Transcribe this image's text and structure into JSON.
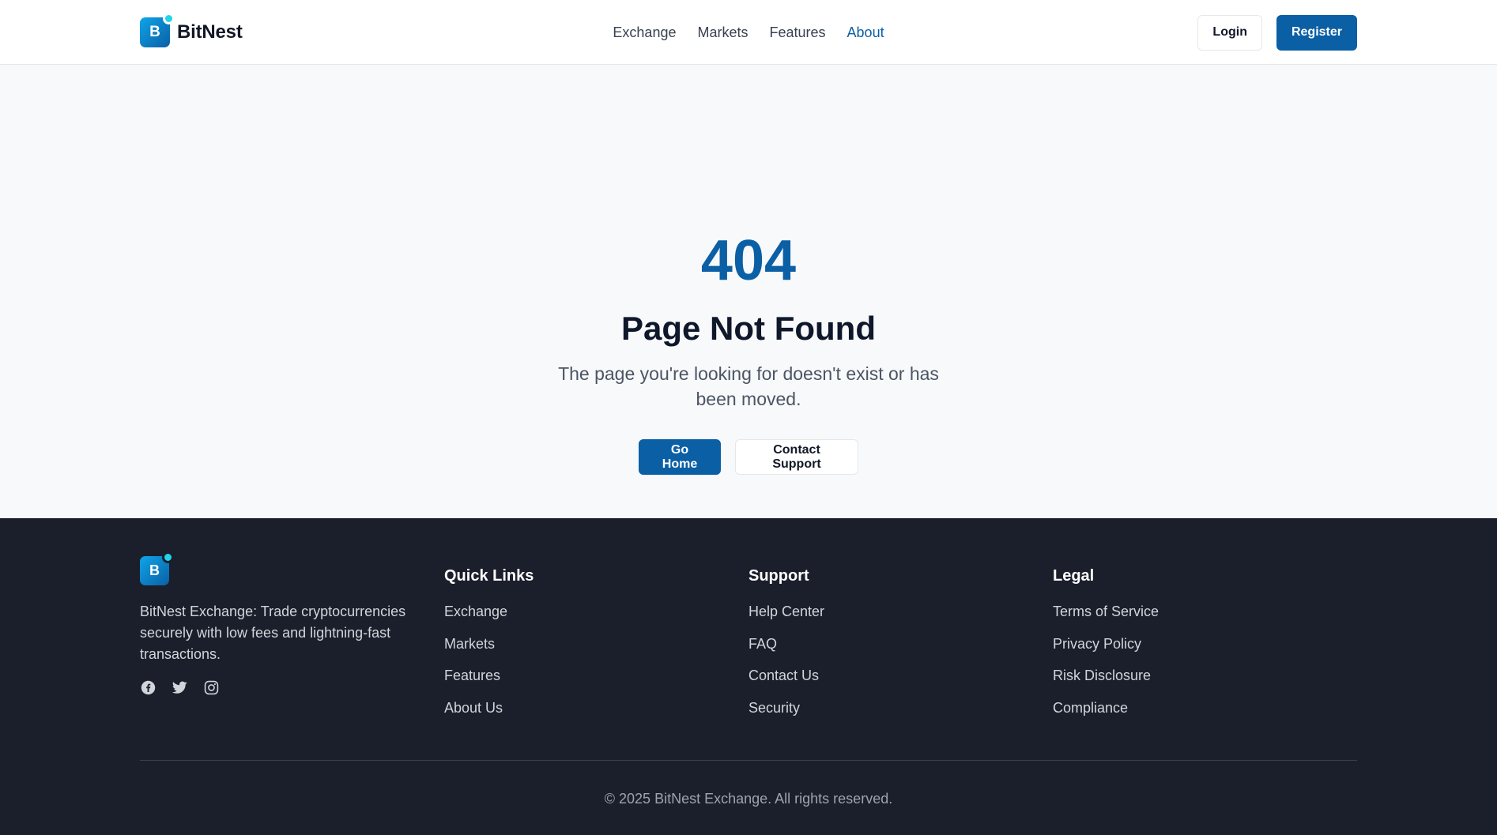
{
  "brand": {
    "name": "BitNest",
    "logo_letter": "B"
  },
  "nav": {
    "items": [
      {
        "label": "Exchange",
        "active": false
      },
      {
        "label": "Markets",
        "active": false
      },
      {
        "label": "Features",
        "active": false
      },
      {
        "label": "About",
        "active": true
      }
    ]
  },
  "header": {
    "login_label": "Login",
    "register_label": "Register"
  },
  "error": {
    "code": "404",
    "title": "Page Not Found",
    "message": "The page you're looking for doesn't exist or has been moved.",
    "home_label": "Go Home",
    "support_label": "Contact Support"
  },
  "footer": {
    "logo_letter": "B",
    "description": "BitNest Exchange: Trade cryptocurrencies securely with low fees and lightning-fast transactions.",
    "socials": [
      "facebook-icon",
      "twitter-icon",
      "instagram-icon"
    ],
    "columns": [
      {
        "heading": "Quick Links",
        "links": [
          "Exchange",
          "Markets",
          "Features",
          "About Us"
        ]
      },
      {
        "heading": "Support",
        "links": [
          "Help Center",
          "FAQ",
          "Contact Us",
          "Security"
        ]
      },
      {
        "heading": "Legal",
        "links": [
          "Terms of Service",
          "Privacy Policy",
          "Risk Disclosure",
          "Compliance"
        ]
      }
    ],
    "copyright": "© 2025 BitNest Exchange. All rights reserved."
  },
  "colors": {
    "primary": "#0b5fa5",
    "accent": "#22d3ee",
    "footer_bg": "#1b1f2b",
    "page_bg": "#f8f9fb"
  }
}
